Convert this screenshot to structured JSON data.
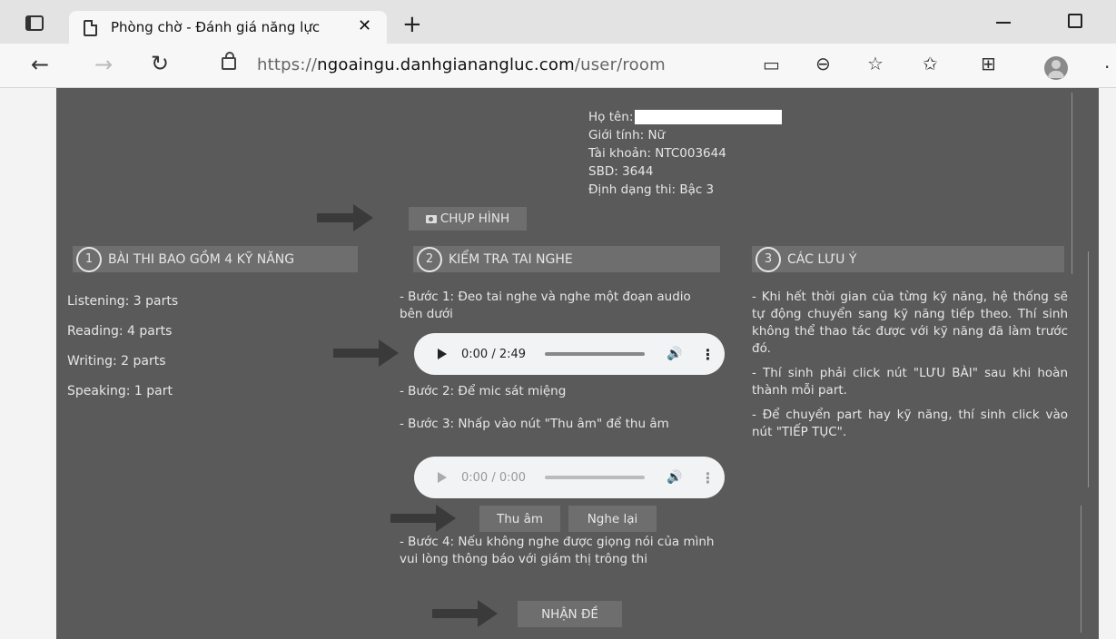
{
  "browser": {
    "tab_title": "Phòng chờ - Đánh giá năng lực",
    "tab_close": "✕",
    "new_tab": "+",
    "url_path": "/user/room",
    "url_scheme": "https://",
    "url_domain": "ngoaingu.danhgianangluc.com"
  },
  "candidate": {
    "name_label": "Họ tên:",
    "gender": "Giới tính: Nữ",
    "account": "Tài khoản: NTC003644",
    "sbd": "SBD: 3644",
    "exam_format": "Định dạng thi: Bậc 3"
  },
  "photo_button": "CHỤP HÌNH",
  "sections": [
    {
      "num": "1",
      "title": "BÀI THI BAO GỒM 4 KỸ NĂNG"
    },
    {
      "num": "2",
      "title": "KIỂM TRA TAI NGHE"
    },
    {
      "num": "3",
      "title": "CÁC LƯU Ý"
    }
  ],
  "skills": [
    "Listening: 3 parts",
    "Reading: 4 parts",
    "Writing: 2 parts",
    "Speaking: 1 part"
  ],
  "headset": {
    "step1": "- Bước 1: Đeo tai nghe và nghe một đoạn audio bên dưới",
    "player1_time": "0:00 / 2:49",
    "step2": "- Bước 2: Để mic sát miệng",
    "step3": "- Bước 3: Nhấp vào nút \"Thu âm\" để thu âm",
    "player2_time": "0:00 / 0:00",
    "record_label": "Thu âm",
    "replay_label": "Nghe lại",
    "step4": "- Bước 4: Nếu không nghe được giọng nói của mình vui lòng thông báo với giám thị trông thi",
    "receive_label": "NHẬN ĐỀ"
  },
  "notes": [
    "- Khi hết thời gian của từng kỹ năng, hệ thống sẽ tự động chuyển sang kỹ năng tiếp theo. Thí sinh không thể thao tác được với kỹ năng đã làm trước đó.",
    "- Thí sinh phải click nút \"LƯU BÀI\" sau khi hoàn thành mỗi part.",
    "- Để chuyển part hay kỹ năng, thí sinh click vào nút \"TIẾP TỤC\"."
  ]
}
